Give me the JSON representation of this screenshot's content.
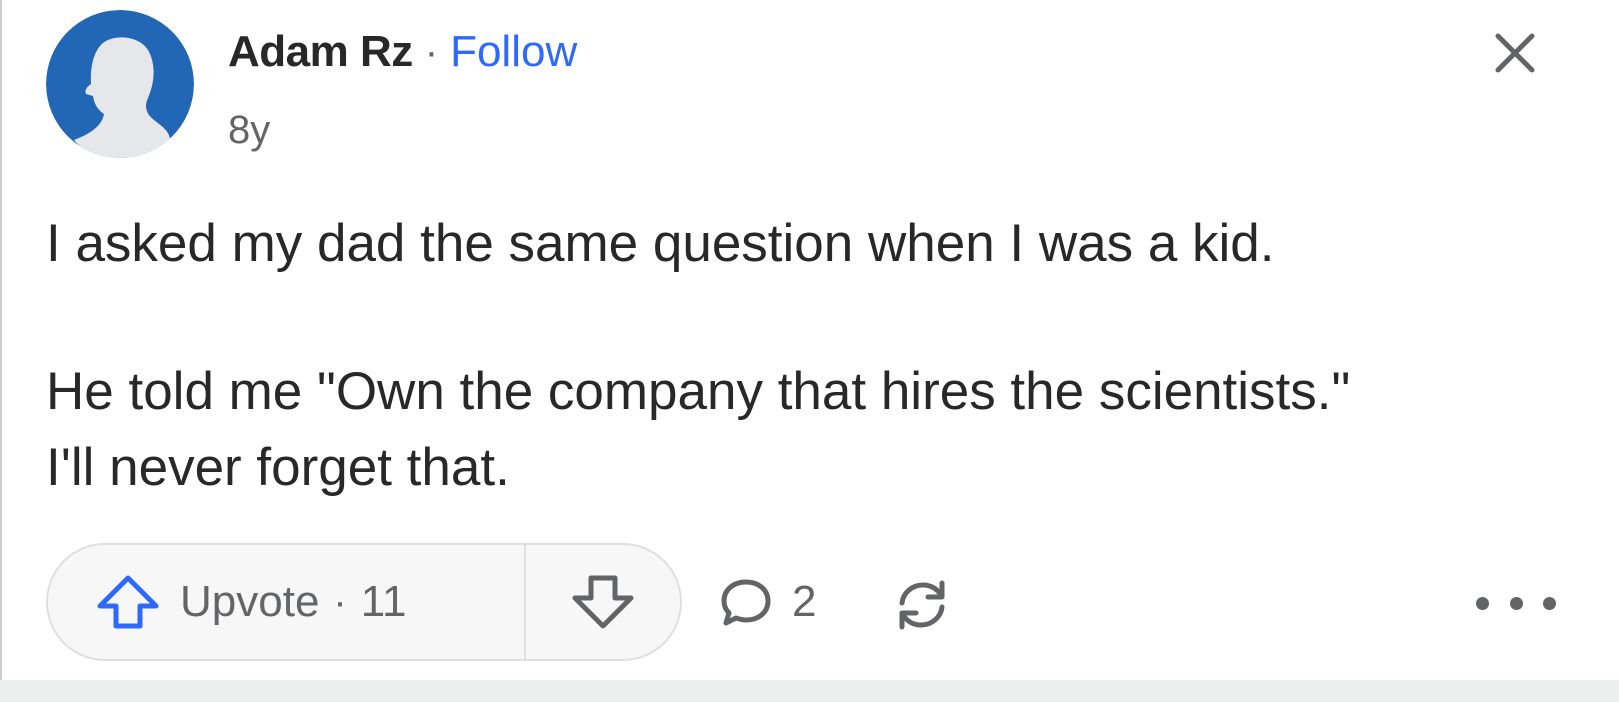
{
  "post": {
    "author": {
      "name": "Adam Rz",
      "separator": "·",
      "follow_label": "Follow",
      "timestamp": "8y"
    },
    "body": {
      "paragraph_1": "I asked my dad the same question when I was a kid.",
      "paragraph_2_line_1": "He told me \"Own the company that hires the scientists.\"",
      "paragraph_2_line_2": "I'll never forget that."
    },
    "actions": {
      "upvote_label": "Upvote",
      "upvote_separator": "·",
      "upvote_count": "11",
      "comment_count": "2"
    }
  },
  "icons": {
    "avatar": "default-user-avatar-icon",
    "close": "close-icon",
    "upvote": "upvote-arrow-icon",
    "downvote": "downvote-arrow-icon",
    "comment": "comment-bubble-icon",
    "share": "share-rotate-icon",
    "more": "more-dots-icon"
  },
  "colors": {
    "accent_blue": "#2e69ff",
    "avatar_blue": "#2167b5",
    "text_primary": "#282829",
    "text_secondary": "#636466",
    "pill_border": "#dedfe0",
    "footer_strip": "#eceded"
  }
}
